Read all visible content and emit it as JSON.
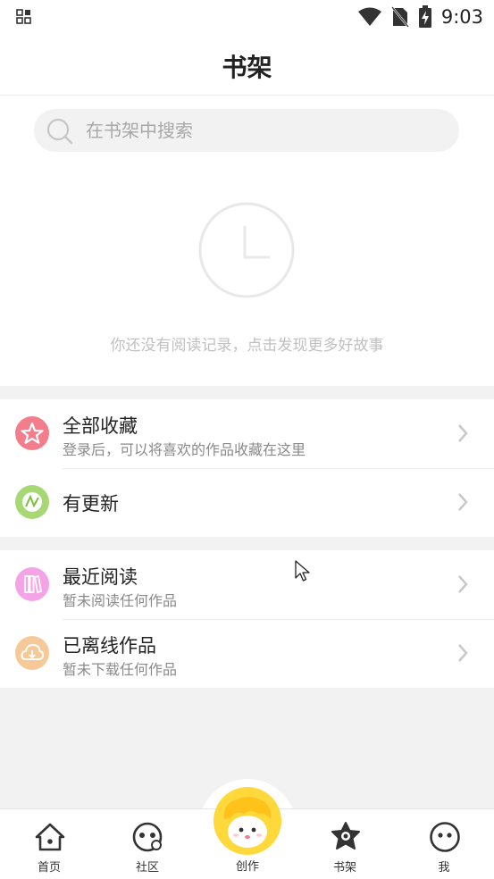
{
  "status_bar": {
    "time": "9:03"
  },
  "header": {
    "title": "书架"
  },
  "search": {
    "placeholder": "在书架中搜索"
  },
  "empty_state": {
    "message": "你还没有阅读记录，点击发现更多好故事"
  },
  "group1": [
    {
      "title": "全部收藏",
      "subtitle": "登录后，可以将喜欢的作品收藏在这里",
      "icon": "star-icon",
      "color": "#f37d8a"
    },
    {
      "title": "有更新",
      "subtitle": "",
      "icon": "update-icon",
      "color": "#a7d873"
    }
  ],
  "group2": [
    {
      "title": "最近阅读",
      "subtitle": "暂未阅读任何作品",
      "icon": "books-icon",
      "color": "#f3a3e6"
    },
    {
      "title": "已离线作品",
      "subtitle": "暂未下载任何作品",
      "icon": "cloud-download-icon",
      "color": "#f7c998"
    }
  ],
  "tabs": [
    {
      "label": "首页",
      "icon": "home-icon"
    },
    {
      "label": "社区",
      "icon": "community-icon"
    },
    {
      "label": "创作",
      "icon": "create-icon"
    },
    {
      "label": "书架",
      "icon": "bookshelf-icon"
    },
    {
      "label": "我",
      "icon": "profile-icon"
    }
  ],
  "colors": {
    "accent": "#ffd93b",
    "page_bg": "#f2f2f2"
  }
}
